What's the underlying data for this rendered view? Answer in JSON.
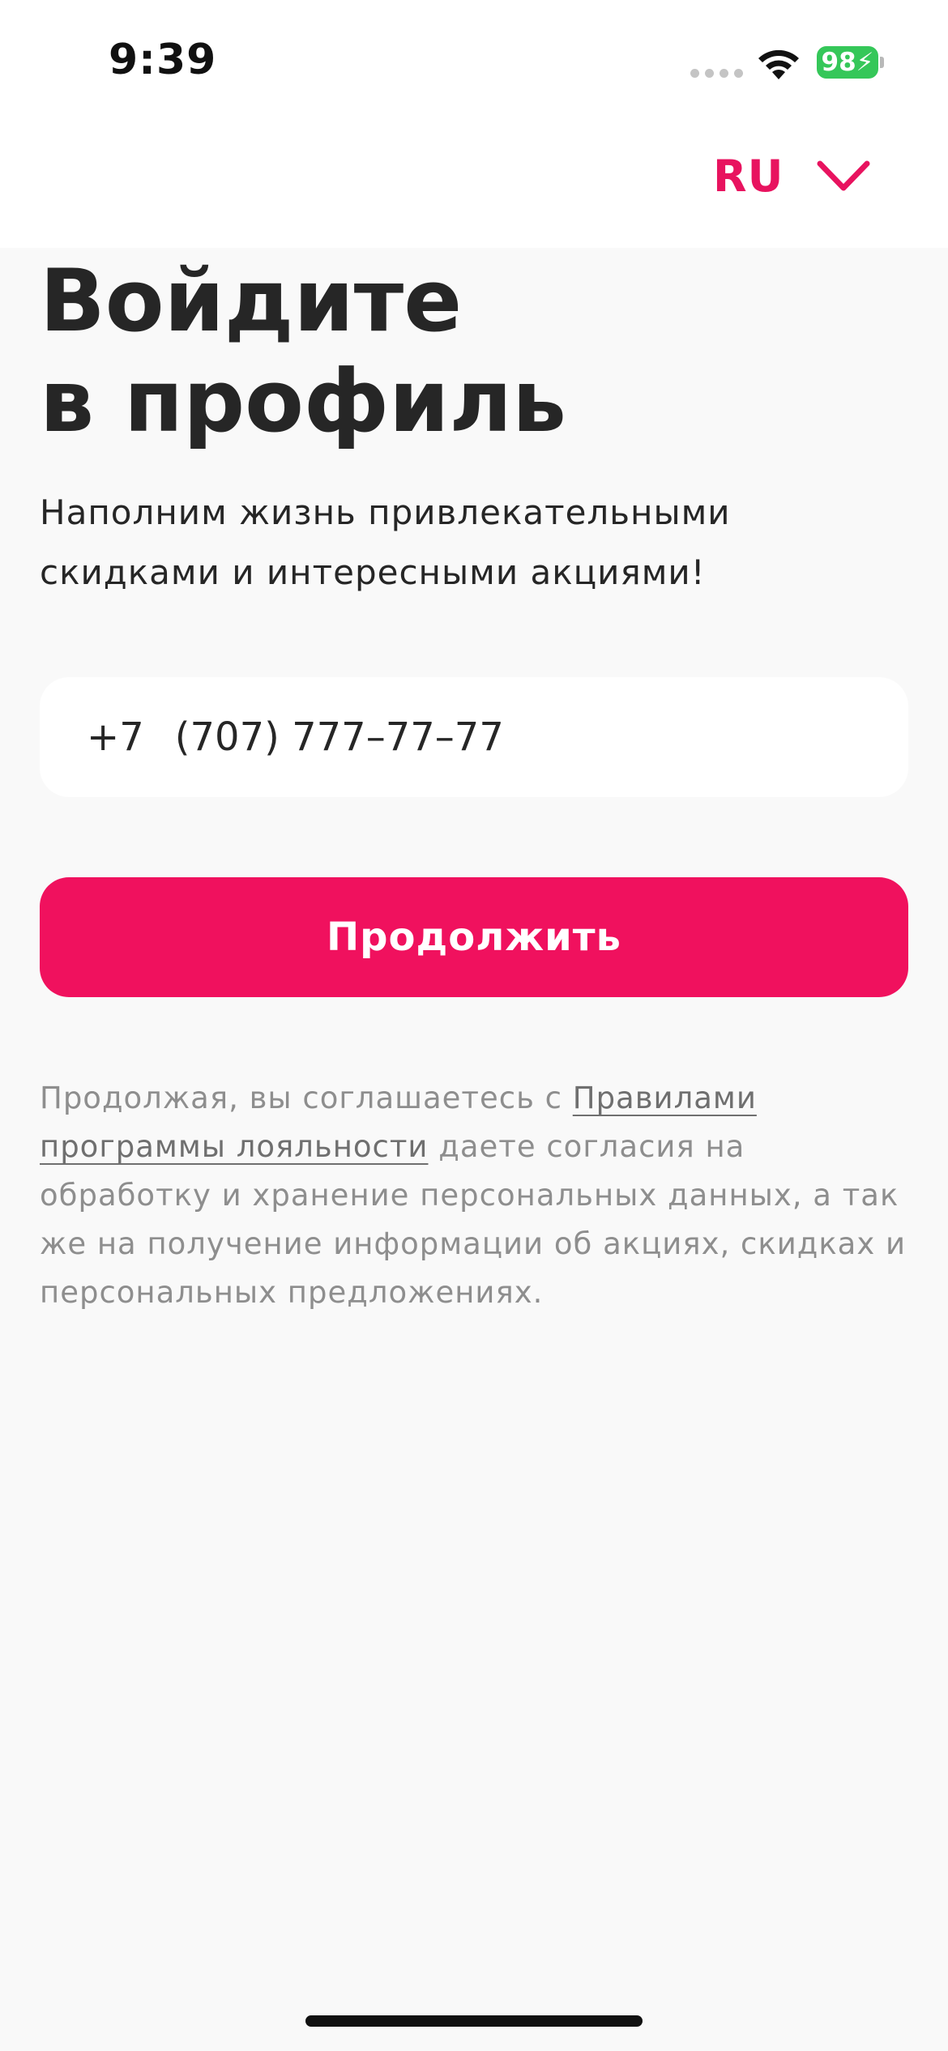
{
  "status_bar": {
    "time": "9:39",
    "battery": "98"
  },
  "header": {
    "language": "RU"
  },
  "main": {
    "title_line1": "Войдите",
    "title_line2": "в профиль",
    "subtitle_line1": "Наполним жизнь привлекательными",
    "subtitle_line2": "скидками и интересными акциями!",
    "phone_prefix": "+7",
    "phone_value": "(707) 777–77–77",
    "continue_label": "Продолжить"
  },
  "legal": {
    "line1_text": "Продолжая, вы соглашаетесь с ",
    "link_part1": "Правилами",
    "link_part2": "программы лояльности",
    "line2_text": " даете согласия на",
    "line3": "обработку и хранение персональных данных, а так",
    "line4": "же на получение информации об акциях, скидках и",
    "line5": "персональных предложениях."
  },
  "colors": {
    "accent": "#f0115e",
    "battery": "#35c759",
    "background": "#f9f9f9"
  },
  "icons": {
    "language_dropdown": "chevron-down-icon",
    "wifi": "wifi-icon",
    "signal": "cellular-signal-icon",
    "battery": "battery-charging-icon"
  }
}
